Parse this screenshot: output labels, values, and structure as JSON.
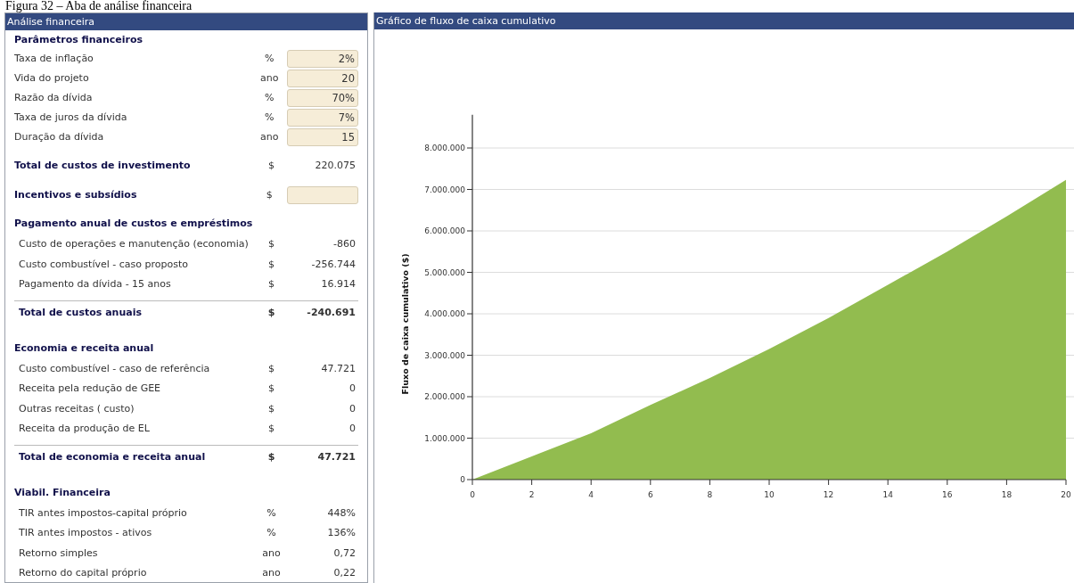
{
  "caption": "Figura 32 – Aba de análise financeira",
  "left_panel": {
    "title": "Análise financeira",
    "rows": [
      {
        "kind": "heading",
        "label": "Parâmetros financeiros"
      },
      {
        "kind": "input",
        "label": "Taxa de inflação",
        "unit": "%",
        "value": "2%"
      },
      {
        "kind": "input",
        "label": "Vida do projeto",
        "unit": "ano",
        "value": "20"
      },
      {
        "kind": "input",
        "label": "Razão da dívida",
        "unit": "%",
        "value": "70%"
      },
      {
        "kind": "input",
        "label": "Taxa de juros da dívida",
        "unit": "%",
        "value": "7%"
      },
      {
        "kind": "input",
        "label": "Duração da dívida",
        "unit": "ano",
        "value": "15"
      },
      {
        "kind": "heading_value",
        "label": "Total de custos de investimento",
        "unit": "$",
        "value": "220.075"
      },
      {
        "kind": "heading_input",
        "label": "Incentivos e subsídios",
        "unit": "$"
      },
      {
        "kind": "heading",
        "label": "Pagamento anual de custos e empréstimos"
      },
      {
        "kind": "item",
        "label": "Custo de operações e manutenção (economia)",
        "unit": "$",
        "value": "-860"
      },
      {
        "kind": "item",
        "label": "Custo combustível - caso proposto",
        "unit": "$",
        "value": "-256.744"
      },
      {
        "kind": "item",
        "label": "Pagamento da dívida - 15 anos",
        "unit": "$",
        "value": "16.914"
      },
      {
        "kind": "total",
        "label": "Total de custos anuais",
        "unit": "$",
        "value": "-240.691"
      },
      {
        "kind": "heading",
        "label": "Economia e receita anual"
      },
      {
        "kind": "item",
        "label": "Custo combustível - caso de referência",
        "unit": "$",
        "value": "47.721"
      },
      {
        "kind": "item",
        "label": "Receita pela redução de GEE",
        "unit": "$",
        "value": "0"
      },
      {
        "kind": "item",
        "label": "Outras receitas ( custo)",
        "unit": "$",
        "value": "0"
      },
      {
        "kind": "item",
        "label": "Receita da produção de EL",
        "unit": "$",
        "value": "0"
      },
      {
        "kind": "total",
        "label": "Total de economia e receita anual",
        "unit": "$",
        "value": "47.721"
      },
      {
        "kind": "heading",
        "label": "Viabil. Financeira"
      },
      {
        "kind": "item",
        "label": "TIR antes impostos-capital próprio",
        "unit": "%",
        "value": "448%"
      },
      {
        "kind": "item",
        "label": "TIR antes impostos - ativos",
        "unit": "%",
        "value": "136%"
      },
      {
        "kind": "item",
        "label": "Retorno simples",
        "unit": "ano",
        "value": "0,72"
      },
      {
        "kind": "item",
        "label": "Retorno do capital próprio",
        "unit": "ano",
        "value": "0,22"
      }
    ]
  },
  "right_panel": {
    "title": "Gráfico de fluxo de caixa cumulativo",
    "chart_data": {
      "type": "area",
      "ylabel": "Fluxo de caixa cumulativo ($)",
      "x": [
        0,
        2,
        4,
        6,
        8,
        10,
        12,
        14,
        16,
        18,
        20
      ],
      "series": [
        {
          "color": "#92bc4f",
          "values": [
            0,
            560000,
            1120000,
            1800000,
            2450000,
            3150000,
            3900000,
            4700000,
            5500000,
            6350000,
            7230000
          ]
        }
      ],
      "xlim": [
        0,
        20
      ],
      "ylim": [
        0,
        8800000
      ],
      "grid": true,
      "xticks": [
        0,
        2,
        4,
        6,
        8,
        10,
        12,
        14,
        16,
        18,
        20
      ],
      "yticks": [
        {
          "value": 0,
          "label": "0"
        },
        {
          "value": 1000000,
          "label": "1.000.000"
        },
        {
          "value": 2000000,
          "label": "2.000.000"
        },
        {
          "value": 3000000,
          "label": "3.000.000"
        },
        {
          "value": 4000000,
          "label": "4.000.000"
        },
        {
          "value": 5000000,
          "label": "5.000.000"
        },
        {
          "value": 6000000,
          "label": "6.000.000"
        },
        {
          "value": 7000000,
          "label": "7.000.000"
        },
        {
          "value": 8000000,
          "label": "8.000.000"
        }
      ]
    }
  }
}
